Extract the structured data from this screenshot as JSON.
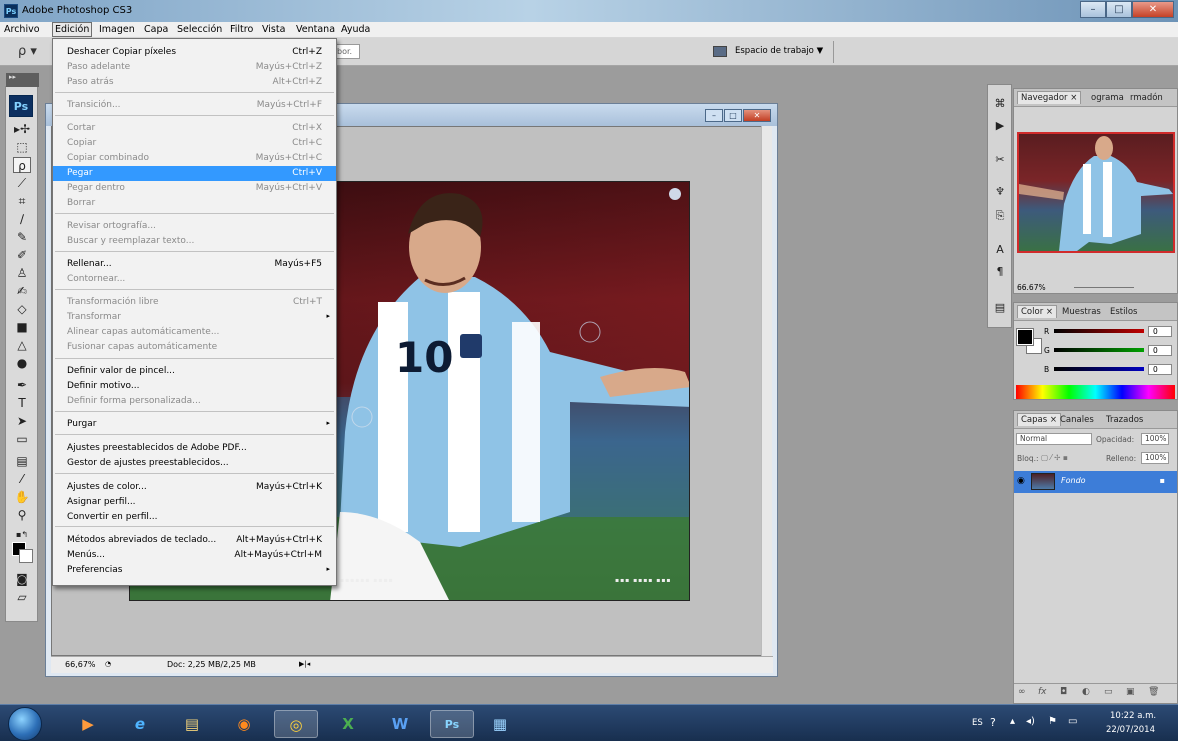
{
  "app": {
    "title": "Adobe Photoshop CS3",
    "logo": "Ps"
  },
  "window_controls": {
    "minimize": "–",
    "maximize": "□",
    "close": "✕"
  },
  "menubar": {
    "items": [
      "Archivo",
      "Edición",
      "Imagen",
      "Capa",
      "Selección",
      "Filtro",
      "Vista",
      "Ventana",
      "Ayuda"
    ],
    "active": "Edición"
  },
  "options_bar": {
    "field_partial": "bor.",
    "workspace_label": "Espacio de trabajo ▼"
  },
  "edit_menu": {
    "items": [
      {
        "label": "Deshacer Copiar píxeles",
        "shortcut": "Ctrl+Z",
        "enabled": true
      },
      {
        "label": "Paso adelante",
        "shortcut": "Mayús+Ctrl+Z",
        "enabled": false
      },
      {
        "label": "Paso atrás",
        "shortcut": "Alt+Ctrl+Z",
        "enabled": false
      },
      {
        "label": "Transición...",
        "shortcut": "Mayús+Ctrl+F",
        "enabled": false
      },
      {
        "label": "Cortar",
        "shortcut": "Ctrl+X",
        "enabled": false
      },
      {
        "label": "Copiar",
        "shortcut": "Ctrl+C",
        "enabled": false
      },
      {
        "label": "Copiar combinado",
        "shortcut": "Mayús+Ctrl+C",
        "enabled": false
      },
      {
        "label": "Pegar",
        "shortcut": "Ctrl+V",
        "enabled": true,
        "highlighted": true
      },
      {
        "label": "Pegar dentro",
        "shortcut": "Mayús+Ctrl+V",
        "enabled": false
      },
      {
        "label": "Borrar",
        "shortcut": "",
        "enabled": false
      },
      {
        "label": "Revisar ortografía...",
        "shortcut": "",
        "enabled": false
      },
      {
        "label": "Buscar y reemplazar texto...",
        "shortcut": "",
        "enabled": false
      },
      {
        "label": "Rellenar...",
        "shortcut": "Mayús+F5",
        "enabled": true
      },
      {
        "label": "Contornear...",
        "shortcut": "",
        "enabled": false
      },
      {
        "label": "Transformación libre",
        "shortcut": "Ctrl+T",
        "enabled": false
      },
      {
        "label": "Transformar",
        "shortcut": "",
        "enabled": false,
        "submenu": true
      },
      {
        "label": "Alinear capas automáticamente...",
        "shortcut": "",
        "enabled": false
      },
      {
        "label": "Fusionar capas automáticamente",
        "shortcut": "",
        "enabled": false
      },
      {
        "label": "Definir valor de pincel...",
        "shortcut": "",
        "enabled": true
      },
      {
        "label": "Definir motivo...",
        "shortcut": "",
        "enabled": true
      },
      {
        "label": "Definir forma personalizada...",
        "shortcut": "",
        "enabled": false
      },
      {
        "label": "Purgar",
        "shortcut": "",
        "enabled": true,
        "submenu": true
      },
      {
        "label": "Ajustes preestablecidos de Adobe PDF...",
        "shortcut": "",
        "enabled": true
      },
      {
        "label": "Gestor de ajustes preestablecidos...",
        "shortcut": "",
        "enabled": true
      },
      {
        "label": "Ajustes de color...",
        "shortcut": "Mayús+Ctrl+K",
        "enabled": true
      },
      {
        "label": "Asignar perfil...",
        "shortcut": "",
        "enabled": true
      },
      {
        "label": "Convertir en perfil...",
        "shortcut": "",
        "enabled": true
      },
      {
        "label": "Métodos abreviados de teclado...",
        "shortcut": "Alt+Mayús+Ctrl+K",
        "enabled": true
      },
      {
        "label": "Menús...",
        "shortcut": "Alt+Mayús+Ctrl+M",
        "enabled": true
      },
      {
        "label": "Preferencias",
        "shortcut": "",
        "enabled": true,
        "submenu": true
      }
    ],
    "submenu_arrow": "▸"
  },
  "document": {
    "zoom": "66,67%",
    "doc_size": "Doc: 2,25 MB/2,25 MB"
  },
  "tools": {
    "logo": "Ps"
  },
  "navigator": {
    "tabs": [
      "Navegador ×",
      "ograma",
      "rmadón"
    ],
    "zoom": "66.67%"
  },
  "color_panel": {
    "tabs": [
      "Color ×",
      "Muestras",
      "Estilos"
    ],
    "channels": [
      {
        "name": "R",
        "value": "0",
        "color": "#c00000"
      },
      {
        "name": "G",
        "value": "0",
        "color": "#00a000"
      },
      {
        "name": "B",
        "value": "0",
        "color": "#0000c0"
      }
    ]
  },
  "layers_panel": {
    "tabs": [
      "Capas ×",
      "Canales",
      "Trazados"
    ],
    "blend_mode": "Normal",
    "opacity_label": "Opacidad:",
    "opacity": "100%",
    "lock_label": "Bloq.:",
    "fill_label": "Relleno:",
    "fill": "100%",
    "layer_name": "Fondo"
  },
  "taskbar": {
    "apps": [
      "media-player",
      "internet-explorer",
      "file-explorer",
      "firefox",
      "chrome",
      "excel",
      "word",
      "photoshop",
      "network-app"
    ],
    "lang": "ES",
    "time": "10:22 a.m.",
    "date": "22/07/2014"
  }
}
